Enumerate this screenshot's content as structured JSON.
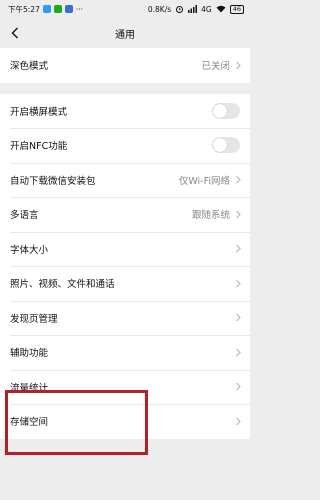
{
  "status_bar": {
    "time": "下午5:27",
    "network_speed": "0.8K/s",
    "signal": "4G",
    "battery": "46"
  },
  "nav": {
    "title": "通用"
  },
  "settings": {
    "dark_mode": {
      "label": "深色模式",
      "value": "已关闭"
    },
    "landscape": {
      "label": "开启横屏模式",
      "enabled": false
    },
    "nfc": {
      "label": "开启NFC功能",
      "enabled": false
    },
    "auto_download": {
      "label": "自动下载微信安装包",
      "value": "仅Wi-Fi网络"
    },
    "language": {
      "label": "多语言",
      "value": "跟随系统"
    },
    "font_size": {
      "label": "字体大小"
    },
    "media": {
      "label": "照片、视频、文件和通话"
    },
    "discover": {
      "label": "发现页管理"
    },
    "accessibility": {
      "label": "辅助功能"
    },
    "traffic": {
      "label": "流量统计"
    },
    "storage": {
      "label": "存储空间"
    }
  },
  "colors": {
    "highlight_border": "#b51f2a",
    "background": "#ededed"
  }
}
